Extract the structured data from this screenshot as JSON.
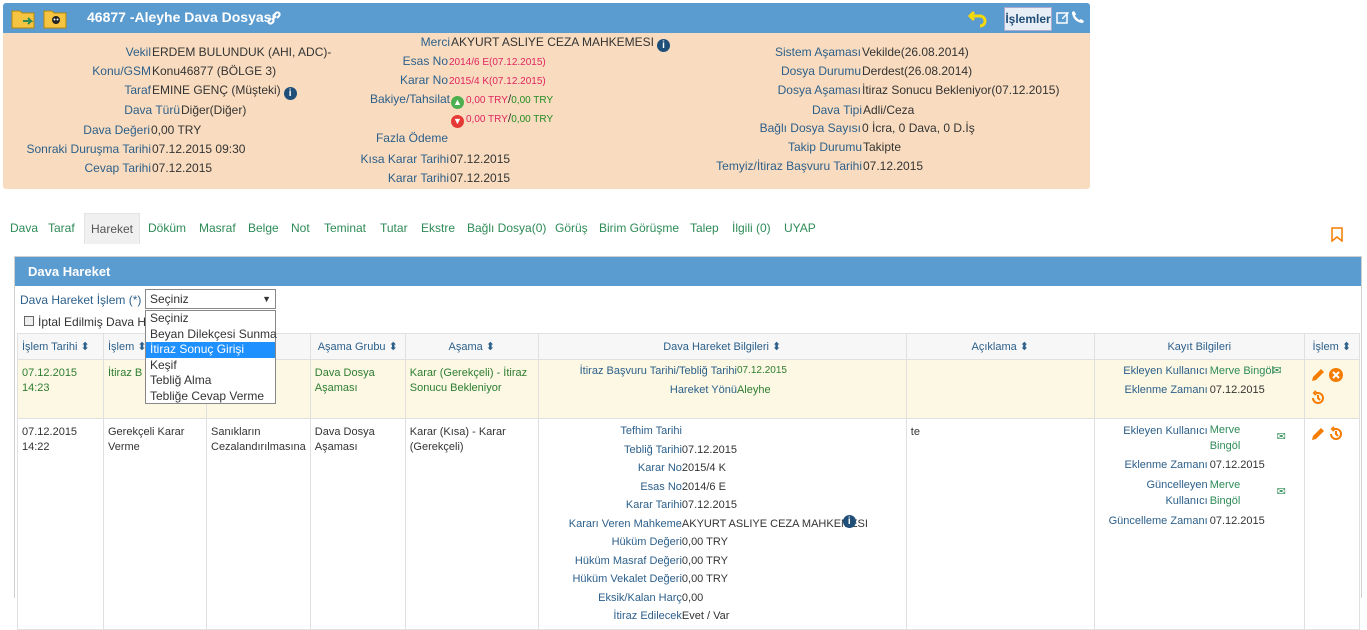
{
  "header": {
    "title": "46877 -Aleyhe Dava Dosyası",
    "menu_label": "İşlemler"
  },
  "left": [
    {
      "label": "Vekil",
      "value": "ERDEM BULUNDUK (AHI, ADC)-"
    },
    {
      "label": "Konu/GSM",
      "value": "Konu46877 (BÖLGE 3)"
    },
    {
      "label": "Taraf",
      "value": "EMINE GENÇ (Müşteki)"
    },
    {
      "label": "Dava Türü",
      "value": "Diğer(Diğer)"
    },
    {
      "label": "Dava Değeri",
      "value": "0,00 TRY"
    },
    {
      "label": "Sonraki Duruşma Tarihi",
      "value": "07.12.2015 09:30"
    },
    {
      "label": "Cevap Tarihi",
      "value": "07.12.2015"
    }
  ],
  "middle": {
    "merci_label": "Merci",
    "merci": "AKYURT ASLIYE CEZA MAHKEMESI",
    "esas_label": "Esas No",
    "esas": "2014/6 E(07.12.2015)",
    "karar_label": "Karar No",
    "karar": "2015/4 K(07.12.2015)",
    "bakiye_label": "Bakiye/Tahsilat",
    "bakiye_1a": "0,00 TRY",
    "bakiye_1b": "0,00 TRY",
    "sep": "/",
    "bakiye_2a": "0,00 TRY",
    "bakiye_2b": "0,00 TRY",
    "fazla_label": "Fazla Ödeme",
    "kisa_label": "Kısa Karar Tarihi",
    "kisa": "07.12.2015",
    "karar_tarihi_label": "Karar Tarihi",
    "karar_tarihi": "07.12.2015"
  },
  "right": [
    {
      "label": "Sistem Aşaması",
      "value": "Vekilde(26.08.2014)"
    },
    {
      "label": "Dosya Durumu",
      "value": "Derdest(26.08.2014)"
    },
    {
      "label": "Dosya Aşaması",
      "value": "İtiraz Sonucu Bekleniyor(07.12.2015)"
    },
    {
      "label": "Dava Tipi",
      "value": "Adli/Ceza"
    },
    {
      "label": "Bağlı Dosya Sayısı",
      "value": "0 İcra, 0 Dava, 0 D.İş"
    },
    {
      "label": "Takip Durumu",
      "value": "Takipte"
    },
    {
      "label": "Temyiz/İtiraz Başvuru Tarihi",
      "value": "07.12.2015"
    }
  ],
  "tabs": [
    "Dava",
    "Taraf",
    "Hareket",
    "Döküm",
    "Masraf",
    "Belge",
    "Not",
    "Teminat",
    "Tutar",
    "Ekstre",
    "Bağlı Dosya(0)",
    "Görüş",
    "Birim Görüşme",
    "Talep",
    "İlgili (0)",
    "UYAP"
  ],
  "panel": {
    "title": "Dava Hareket",
    "form_label": "Dava Hareket İşlem (*)",
    "select_value": "Seçiniz",
    "options": [
      "Seçiniz",
      "Beyan Dilekçesi Sunma",
      "İtiraz Sonuç Girişi",
      "Keşif",
      "Tebliğ Alma",
      "Tebliğe Cevap Verme"
    ],
    "checkbox_label": "İptal Edilmiş Dava H"
  },
  "table": {
    "headers": [
      "İşlem Tarihi ⬍",
      "İşlem ⬍",
      "",
      "Aşama Grubu ⬍",
      "Aşama ⬍",
      "Dava Hareket Bilgileri ⬍",
      "Açıklama ⬍",
      "Kayıt Bilgileri",
      "İşlem ⬍"
    ],
    "row1": {
      "tarih": "07.12.2015 14:23",
      "islem": "İtiraz B",
      "grup": "Dava Dosya Aşaması",
      "asama": "Karar (Gerekçeli) - İtiraz Sonucu Bekleniyor",
      "info_k1": "İtiraz Başvuru Tarihi/Tebliğ Tarihi",
      "info_v1": "07.12.2015",
      "info_k2": "Hareket Yönü",
      "info_v2": "Aleyhe",
      "kayit_k1": "Ekleyen Kullanıcı",
      "kayit_v1": "Merve Bingöl",
      "kayit_k2": "Eklenme Zamanı",
      "kayit_v2": "07.12.2015"
    },
    "row2": {
      "tarih": "07.12.2015 14:22",
      "islem": "Gerekçeli Karar Verme",
      "alt": "Sanıkların Cezalandırılmasına",
      "grup": "Dava Dosya Aşaması",
      "asama": "Karar (Kısa) - Karar (Gerekçeli)",
      "aciklama": "te",
      "info": [
        {
          "k": "Tefhim Tarihi",
          "v": ""
        },
        {
          "k": "Tebliğ Tarihi",
          "v": "07.12.2015"
        },
        {
          "k": "Karar No",
          "v": "2015/4 K"
        },
        {
          "k": "Esas No",
          "v": "2014/6 E"
        },
        {
          "k": "Karar Tarihi",
          "v": "07.12.2015"
        },
        {
          "k": "Kararı Veren Mahkeme",
          "v": "AKYURT ASLIYE CEZA MAHKEMESI"
        },
        {
          "k": "Hüküm Değeri",
          "v": "0,00 TRY"
        },
        {
          "k": "Hüküm Masraf Değeri",
          "v": "0,00 TRY"
        },
        {
          "k": "Hüküm Vekalet Değeri",
          "v": "0,00 TRY"
        },
        {
          "k": "Eksik/Kalan Harç",
          "v": "0,00"
        },
        {
          "k": "İtiraz Edilecek",
          "v": "Evet / Var"
        }
      ],
      "kayit_k1": "Ekleyen Kullanıcı",
      "kayit_v1": "Merve Bingöl",
      "kayit_k2": "Eklenme Zamanı",
      "kayit_v2": "07.12.2015",
      "kayit_k3": "Güncelleyen Kullanıcı",
      "kayit_v3": "Merve Bingöl",
      "kayit_k4": "Güncelleme Zamanı",
      "kayit_v4": "07.12.2015"
    }
  }
}
